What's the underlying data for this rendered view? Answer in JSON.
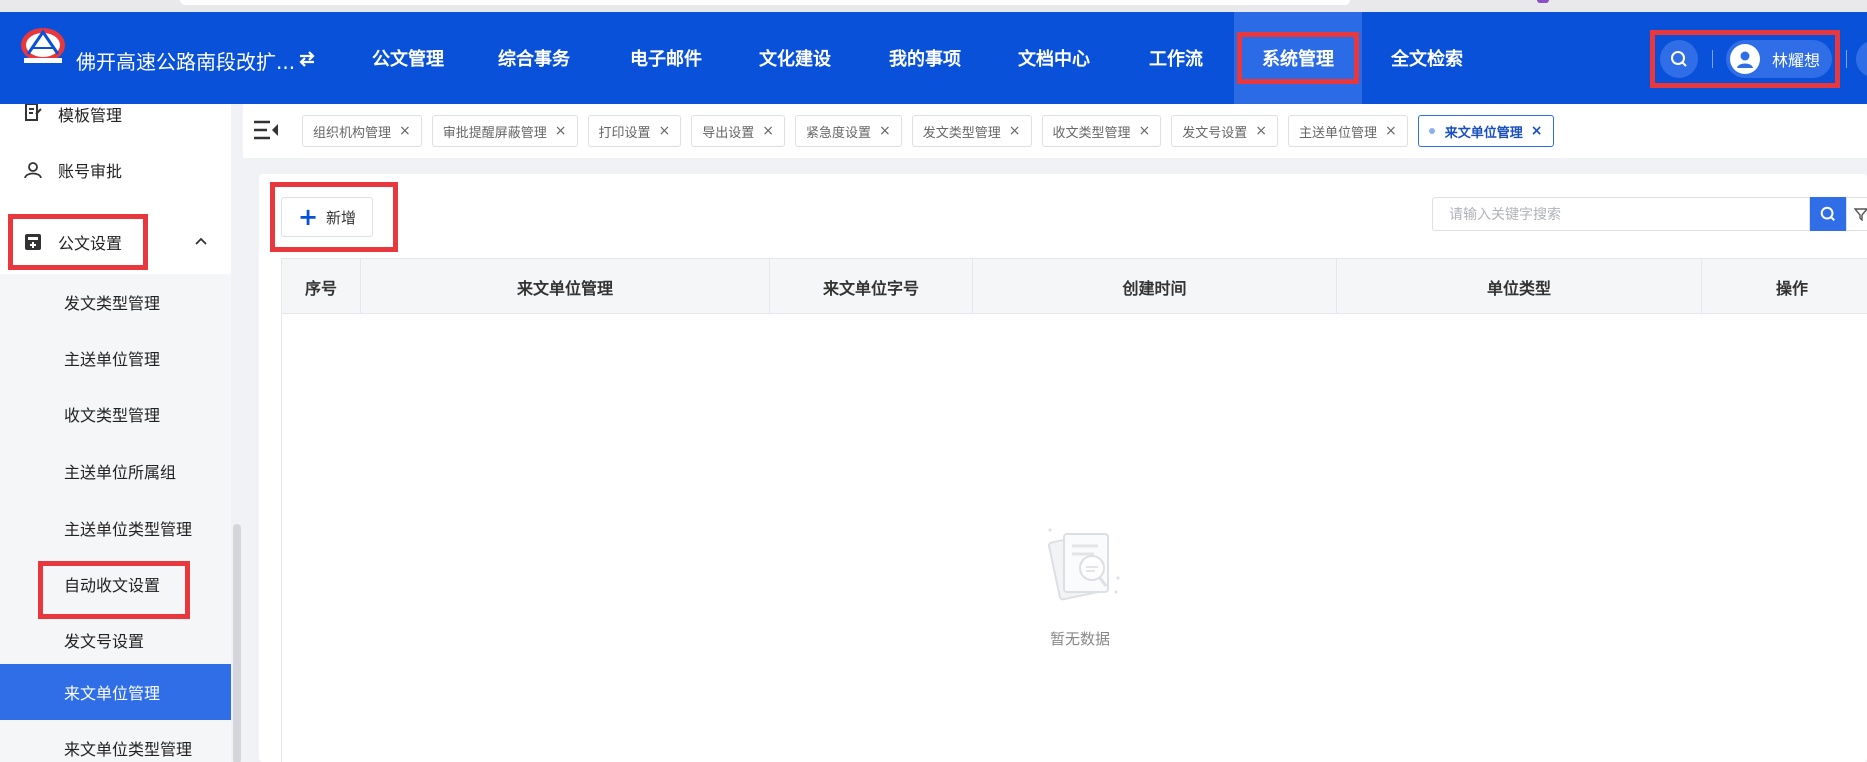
{
  "app": {
    "title": "佛开高速公路南段改扩..."
  },
  "nav": {
    "items": [
      {
        "label": "公文管理"
      },
      {
        "label": "综合事务"
      },
      {
        "label": "电子邮件"
      },
      {
        "label": "文化建设"
      },
      {
        "label": "我的事项"
      },
      {
        "label": "文档中心"
      },
      {
        "label": "工作流"
      },
      {
        "label": "系统管理",
        "active": true
      },
      {
        "label": "全文检索"
      }
    ]
  },
  "user": {
    "name": "林耀想"
  },
  "sidebar": {
    "items": [
      {
        "label": "模板管理",
        "icon": "file-edit-icon"
      },
      {
        "label": "账号审批",
        "icon": "user-outline-icon"
      },
      {
        "label": "公文设置",
        "icon": "document-settings-icon",
        "expanded": true
      }
    ],
    "subitems": [
      {
        "label": "发文类型管理"
      },
      {
        "label": "主送单位管理"
      },
      {
        "label": "收文类型管理"
      },
      {
        "label": "主送单位所属组"
      },
      {
        "label": "主送单位类型管理"
      },
      {
        "label": "自动收文设置"
      },
      {
        "label": "发文号设置"
      },
      {
        "label": "来文单位管理",
        "active": true
      },
      {
        "label": "来文单位类型管理"
      }
    ]
  },
  "tabs": [
    {
      "label": "组织机构管理"
    },
    {
      "label": "审批提醒屏蔽管理"
    },
    {
      "label": "打印设置"
    },
    {
      "label": "导出设置"
    },
    {
      "label": "紧急度设置"
    },
    {
      "label": "发文类型管理"
    },
    {
      "label": "收文类型管理"
    },
    {
      "label": "发文号设置"
    },
    {
      "label": "主送单位管理"
    },
    {
      "label": "来文单位管理",
      "active": true
    }
  ],
  "toolbar": {
    "add_label": "新增",
    "search_placeholder": "请输入关键字搜索"
  },
  "table": {
    "columns": [
      "序号",
      "来文单位管理",
      "来文单位字号",
      "创建时间",
      "单位类型",
      "操作"
    ],
    "rows": [],
    "empty_text": "暂无数据"
  },
  "colors": {
    "header": "#0a51d9",
    "accent": "#2f6ee6",
    "highlight": "#e8383d"
  }
}
